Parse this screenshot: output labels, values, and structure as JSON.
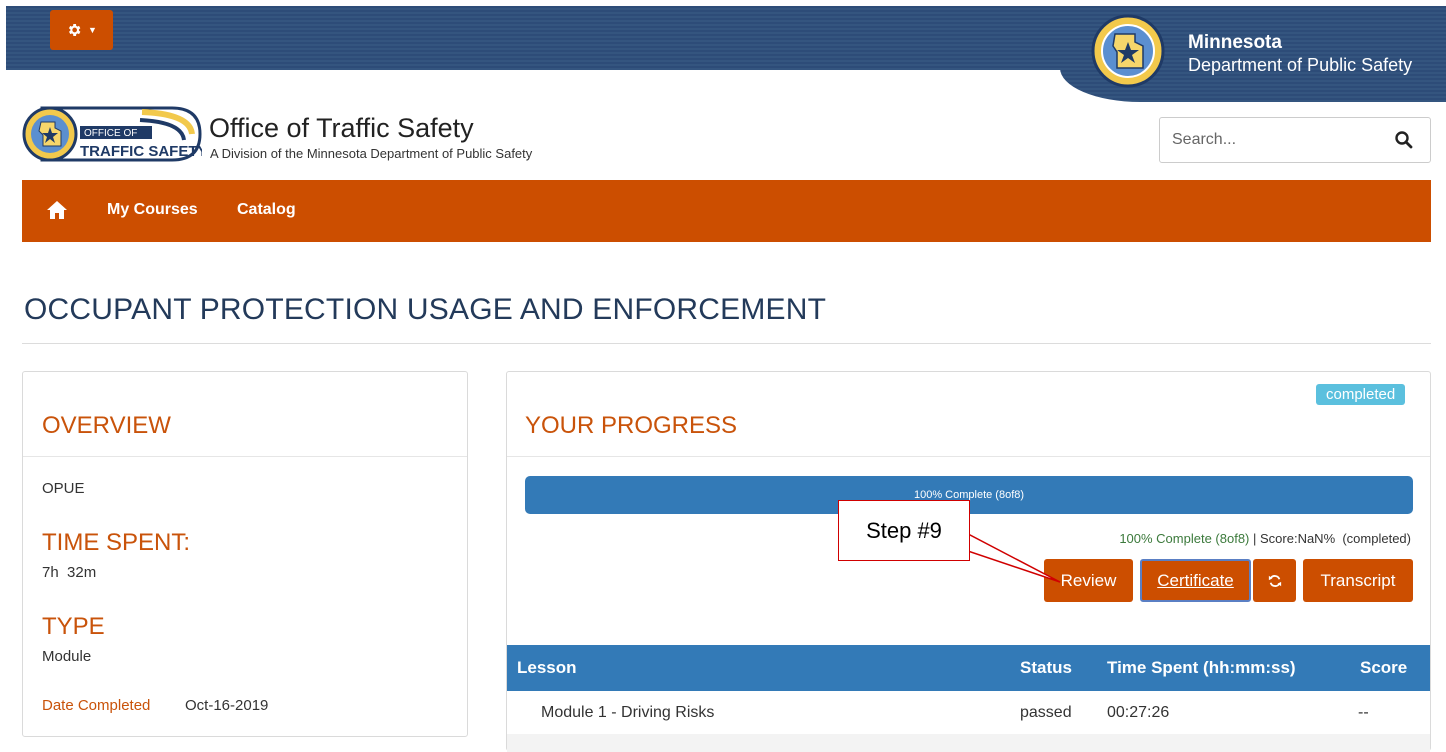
{
  "header": {
    "settings_icon": "gear-icon",
    "state_name": "Minnesota",
    "department_name": "Department of Public Safety"
  },
  "brand": {
    "logo_line1": "OFFICE OF",
    "logo_line2": "TRAFFIC SAFETY",
    "title": "Office of Traffic Safety",
    "subtitle": "A Division of the Minnesota Department of Public Safety"
  },
  "search": {
    "placeholder": "Search...",
    "icon": "search-icon"
  },
  "nav": {
    "home_icon": "home-icon",
    "items": [
      {
        "label": "My Courses"
      },
      {
        "label": "Catalog"
      }
    ],
    "color": "#cc4e00"
  },
  "page": {
    "title": "OCCUPANT PROTECTION USAGE AND ENFORCEMENT"
  },
  "overview": {
    "heading": "OVERVIEW",
    "code": "OPUE",
    "time_spent_heading": "TIME SPENT:",
    "time_spent_value": "7h  32m",
    "type_heading": "TYPE",
    "type_value": "Module",
    "date_completed_label": "Date Completed",
    "date_completed_value": "Oct-16-2019"
  },
  "progress": {
    "heading": "YOUR PROGRESS",
    "status_badge": "completed",
    "percent": 100,
    "bar_label": "100% Complete (8of8)",
    "summary_green": "100% Complete (8of8)",
    "summary_rest": " | Score:NaN%  (completed)",
    "buttons": {
      "review": "Review",
      "certificate": "Certificate",
      "refresh_icon": "refresh-icon",
      "transcript": "Transcript"
    }
  },
  "lessons_table": {
    "columns": [
      "Lesson",
      "Status",
      "Time Spent (hh:mm:ss)",
      "Score"
    ],
    "rows": [
      {
        "lesson": "Module 1 - Driving Risks",
        "status": "passed",
        "time": "00:27:26",
        "score": "--"
      }
    ]
  },
  "annotation": {
    "callout_text": "Step #9",
    "color": "#d00000"
  },
  "colors": {
    "accent_orange": "#cc4e00",
    "heading_orange": "#c9530a",
    "primary_blue": "#337ab7",
    "header_navy": "#2d4c78",
    "badge_cyan": "#5bc0de"
  }
}
